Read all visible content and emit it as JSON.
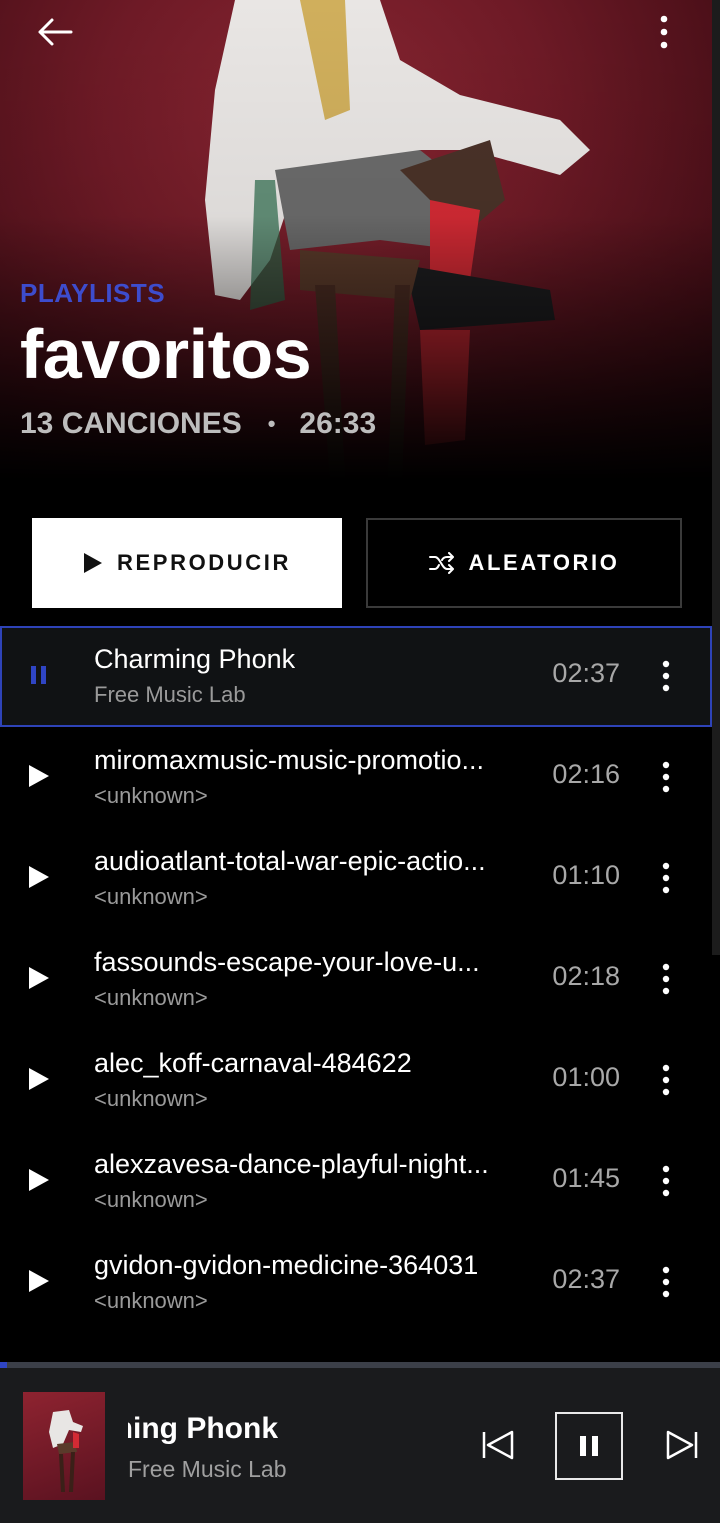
{
  "header": {
    "eyebrow": "PLAYLISTS",
    "title": "favoritos",
    "song_count": "13 CANCIONES",
    "separator": "•",
    "total_duration": "26:33"
  },
  "actions": {
    "play_label": "REPRODUCIR",
    "shuffle_label": "ALEATORIO"
  },
  "tracks": [
    {
      "title": "Charming Phonk",
      "artist": "Free Music Lab",
      "duration": "02:37",
      "state": "playing"
    },
    {
      "title": "miromaxmusic-music-promotio...",
      "artist": "<unknown>",
      "duration": "02:16",
      "state": "idle"
    },
    {
      "title": "audioatlant-total-war-epic-actio...",
      "artist": "<unknown>",
      "duration": "01:10",
      "state": "idle"
    },
    {
      "title": "fassounds-escape-your-love-u...",
      "artist": "<unknown>",
      "duration": "02:18",
      "state": "idle"
    },
    {
      "title": "alec_koff-carnaval-484622",
      "artist": "<unknown>",
      "duration": "01:00",
      "state": "idle"
    },
    {
      "title": "alexzavesa-dance-playful-night...",
      "artist": "<unknown>",
      "duration": "01:45",
      "state": "idle"
    },
    {
      "title": "gvidon-gvidon-medicine-364031",
      "artist": "<unknown>",
      "duration": "02:37",
      "state": "idle"
    }
  ],
  "player": {
    "title": "Charming Phonk",
    "artist": "Free Music Lab",
    "progress": 0.01
  },
  "colors": {
    "accent": "#2f45c4",
    "eyebrow": "#3d4ccd",
    "hero_red": "#6e1a26"
  },
  "icons": {
    "back": "arrow-left-icon",
    "menu": "more-vertical-icon",
    "play": "play-icon",
    "pause": "pause-icon",
    "shuffle": "shuffle-icon",
    "previous": "skip-previous-icon",
    "next": "skip-next-icon"
  }
}
